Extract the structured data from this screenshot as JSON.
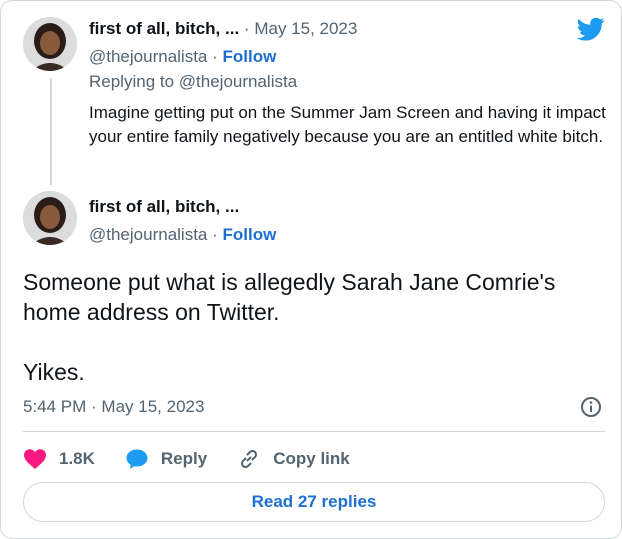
{
  "brand": {
    "logo_icon": "twitter-bird-icon",
    "accent": "#1d9bf0",
    "link_color": "#1d6fd1"
  },
  "reply_tweet": {
    "author_name": "first of all, bitch, ...",
    "separator": "·",
    "date": "May 15, 2023",
    "handle": "@thejournalista",
    "handle_sep": "·",
    "follow_label": "Follow",
    "replying_to": "Replying to @thejournalista",
    "text": "Imagine getting put on the Summer Jam Screen and having it impact your entire family negatively because you are an entitled white bitch."
  },
  "main_tweet": {
    "author_name": "first of all, bitch, ...",
    "handle": "@thejournalista",
    "handle_sep": "·",
    "follow_label": "Follow",
    "text_p1": "Someone put what is allegedly Sarah Jane Comrie's home address on Twitter.",
    "text_p2": "Yikes.",
    "timestamp": "5:44 PM · May 15, 2023"
  },
  "actions": {
    "like_count": "1.8K",
    "reply_label": "Reply",
    "copy_link_label": "Copy link",
    "like_color": "#f91880",
    "reply_color": "#1d9bf0"
  },
  "read_replies_label": "Read 27 replies"
}
